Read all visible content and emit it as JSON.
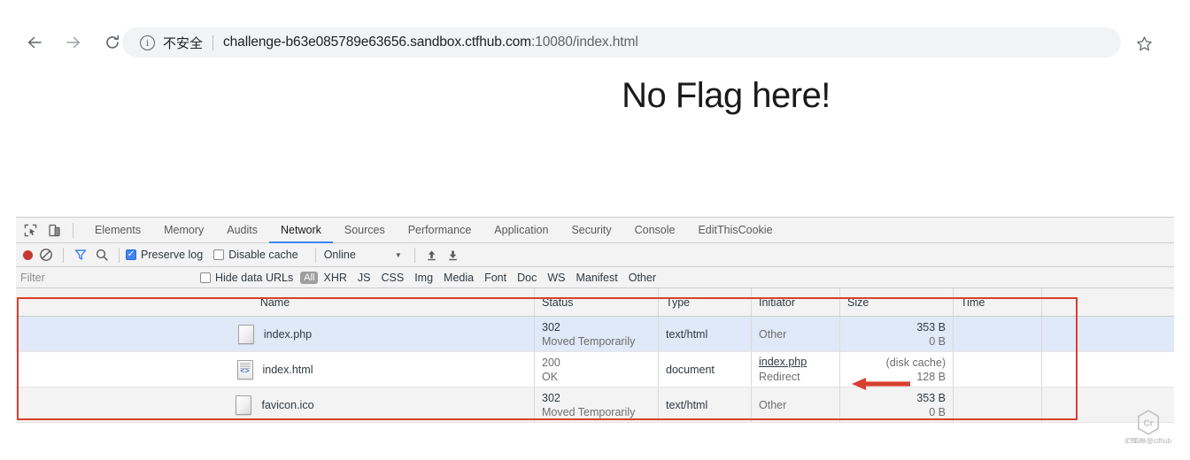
{
  "browser": {
    "back_icon": "arrow-left-icon",
    "forward_icon": "arrow-right-icon",
    "reload_icon": "reload-icon",
    "info_icon": "info-circle-icon",
    "security_label": "不安全",
    "url_host": "challenge-b63e085789e63656.sandbox.ctfhub.com",
    "url_port": ":10080",
    "url_path": "/index.html",
    "bookmark_icon": "star-outline-icon"
  },
  "page": {
    "heading": "No Flag here!"
  },
  "devtools": {
    "inspect_icon": "inspect-element-icon",
    "device_icon": "device-toolbar-icon",
    "tabs": [
      {
        "label": "Elements",
        "active": false
      },
      {
        "label": "Memory",
        "active": false
      },
      {
        "label": "Audits",
        "active": false
      },
      {
        "label": "Network",
        "active": true
      },
      {
        "label": "Sources",
        "active": false
      },
      {
        "label": "Performance",
        "active": false
      },
      {
        "label": "Application",
        "active": false
      },
      {
        "label": "Security",
        "active": false
      },
      {
        "label": "Console",
        "active": false
      },
      {
        "label": "EditThisCookie",
        "active": false
      }
    ],
    "controls": {
      "record_icon": "record-circle-icon",
      "clear_icon": "clear-no-entry-icon",
      "filter_icon": "funnel-filter-icon",
      "search_icon": "search-icon",
      "preserve_log_label": "Preserve log",
      "preserve_log_checked": true,
      "disable_cache_label": "Disable cache",
      "disable_cache_checked": false,
      "throttle_value": "Online",
      "throttle_caret_icon": "chevron-down-icon",
      "import_icon": "upload-arrow-icon",
      "export_icon": "download-arrow-icon",
      "accent_color": "#4285f4",
      "record_color": "#c8382f"
    },
    "filterbar": {
      "filter_placeholder": "Filter",
      "hide_data_urls_label": "Hide data URLs",
      "hide_data_urls_checked": false,
      "types": [
        "All",
        "XHR",
        "JS",
        "CSS",
        "Img",
        "Media",
        "Font",
        "Doc",
        "WS",
        "Manifest",
        "Other"
      ],
      "selected_type": "All"
    },
    "table": {
      "columns": [
        "Name",
        "Status",
        "Type",
        "Initiator",
        "Size",
        "Time"
      ],
      "rows": [
        {
          "name": "index.php",
          "icon": "generic-file-icon",
          "status": "302",
          "status_sub": "Moved Temporarily",
          "type": "text/html",
          "initiator": "Other",
          "initiator_sub": "",
          "initiator_is_link": false,
          "size": "353 B",
          "size_sub": "0 B",
          "time": "",
          "selected": true
        },
        {
          "name": "index.html",
          "icon": "html-document-icon",
          "status": "200",
          "status_sub": "OK",
          "type": "document",
          "initiator": "index.php",
          "initiator_sub": "Redirect",
          "initiator_is_link": true,
          "size": "(disk cache)",
          "size_sub": "128 B",
          "time": "",
          "selected": false
        },
        {
          "name": "favicon.ico",
          "icon": "generic-file-icon",
          "status": "302",
          "status_sub": "Moved Temporarily",
          "type": "text/html",
          "initiator": "Other",
          "initiator_sub": "",
          "initiator_is_link": false,
          "size": "353 B",
          "size_sub": "0 B",
          "time": "",
          "selected": false
        }
      ]
    }
  },
  "annotations": {
    "highlight_box_color": "#d9402f",
    "arrow_color": "#d9402f",
    "arrow_target": "initiator-index.php-link"
  },
  "watermark": {
    "logo_icon": "ctfhub-logo-icon",
    "text": "CSDN @ctfhub",
    "text_overlay": "(ctfhub:)"
  }
}
